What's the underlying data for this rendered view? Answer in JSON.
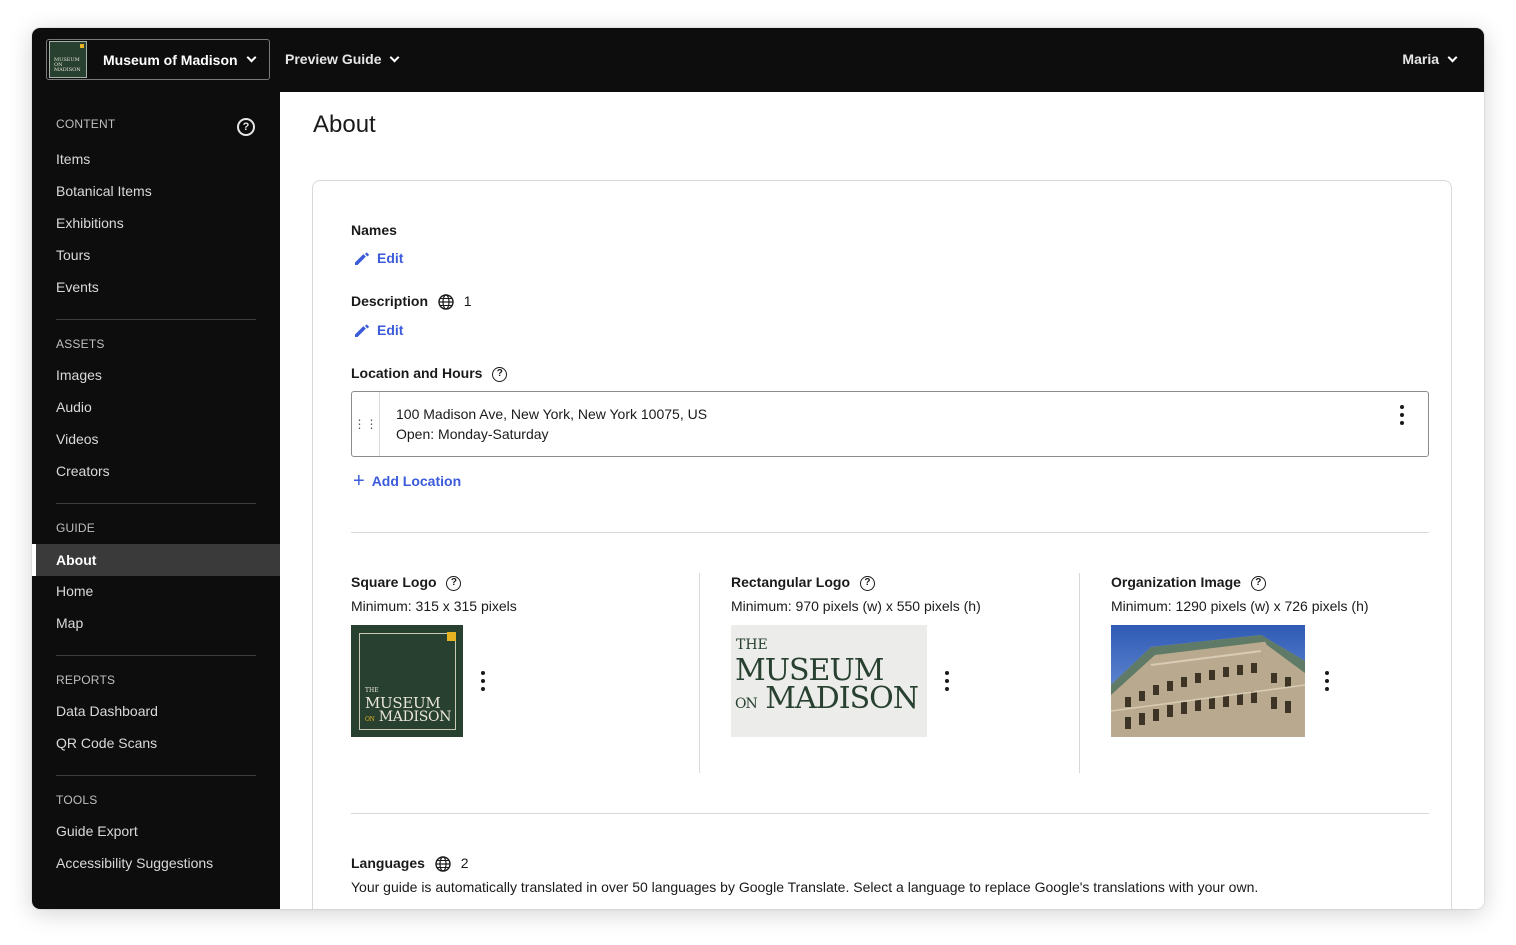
{
  "topbar": {
    "org_name": "Museum of Madison",
    "org_logo_text": "MUSEUM ON MADISON",
    "preview_label": "Preview Guide",
    "user_name": "Maria"
  },
  "sidebar": {
    "sections": [
      {
        "title": "CONTENT",
        "items": [
          "Items",
          "Botanical Items",
          "Exhibitions",
          "Tours",
          "Events"
        ]
      },
      {
        "title": "ASSETS",
        "items": [
          "Images",
          "Audio",
          "Videos",
          "Creators"
        ]
      },
      {
        "title": "GUIDE",
        "items": [
          "About",
          "Home",
          "Map"
        ]
      },
      {
        "title": "REPORTS",
        "items": [
          "Data Dashboard",
          "QR Code Scans"
        ]
      },
      {
        "title": "TOOLS",
        "items": [
          "Guide Export",
          "Accessibility Suggestions"
        ]
      }
    ],
    "active_item": "About"
  },
  "main": {
    "title": "About",
    "names": {
      "label": "Names",
      "edit": "Edit"
    },
    "description": {
      "label": "Description",
      "count": "1",
      "edit": "Edit"
    },
    "location": {
      "label": "Location and Hours",
      "address": "100 Madison Ave, New York, New York 10075, US",
      "hours": "Open: Monday-Saturday",
      "add_label": "Add Location"
    },
    "square_logo": {
      "label": "Square Logo",
      "minimum": "Minimum: 315 x 315 pixels",
      "logo_small": "THE",
      "logo_line1": "MUSEUM",
      "logo_on": "ON",
      "logo_line2": "MADISON"
    },
    "rect_logo": {
      "label": "Rectangular Logo",
      "minimum": "Minimum: 970 pixels (w) x 550 pixels (h)",
      "logo_small": "THE",
      "logo_line1": "MUSEUM",
      "logo_on": "ON",
      "logo_line2": "MADISON"
    },
    "org_image": {
      "label": "Organization Image",
      "minimum": "Minimum: 1290 pixels (w) x 726 pixels (h)"
    },
    "languages": {
      "label": "Languages",
      "count": "2",
      "description": "Your guide is automatically translated in over 50 languages by Google Translate. Select a language to replace Google's translations with your own."
    }
  },
  "colors": {
    "accent": "#3b5bdb",
    "dark": "#0d0d0d",
    "brand_green": "#27402f",
    "brand_gold": "#e6b422"
  }
}
